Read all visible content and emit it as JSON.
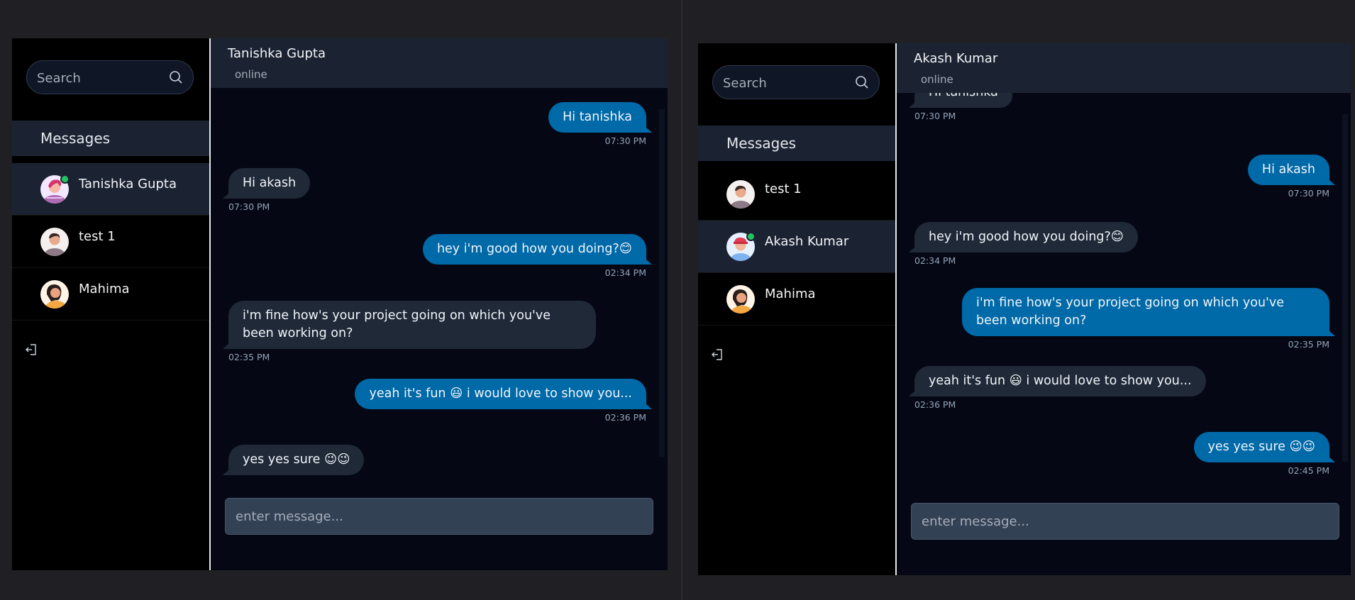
{
  "left": {
    "search_placeholder": "Search",
    "messages_header": "Messages",
    "contacts": [
      {
        "name": "Tanishka Gupta",
        "active": true,
        "online": true
      },
      {
        "name": "test 1"
      },
      {
        "name": "Mahima"
      }
    ],
    "chat": {
      "name": "Tanishka Gupta",
      "status": "online",
      "messages": [
        {
          "dir": "sent",
          "text": "Hi tanishka",
          "time": "07:30 PM"
        },
        {
          "dir": "recv",
          "text": "Hi akash",
          "time": "07:30 PM"
        },
        {
          "dir": "sent",
          "text": "hey i'm good how you doing?😊",
          "time": "02:34 PM"
        },
        {
          "dir": "recv",
          "text": "i'm fine how's your project going on which you've been working on?",
          "time": "02:35 PM"
        },
        {
          "dir": "sent",
          "text": "yeah it's fun 😃 i would love to show you...",
          "time": "02:36 PM"
        },
        {
          "dir": "recv",
          "text": "yes yes sure 😉😉",
          "time": ""
        }
      ],
      "input_placeholder": "enter message..."
    }
  },
  "right": {
    "search_placeholder": "Search",
    "messages_header": "Messages",
    "contacts": [
      {
        "name": "test 1"
      },
      {
        "name": "Akash Kumar",
        "active": true,
        "online": true
      },
      {
        "name": "Mahima"
      }
    ],
    "chat": {
      "name": "Akash Kumar",
      "status": "online",
      "messages": [
        {
          "dir": "recv",
          "text": "Hi tanishka",
          "time": "07:30 PM"
        },
        {
          "dir": "sent",
          "text": "Hi akash",
          "time": "07:30 PM"
        },
        {
          "dir": "recv",
          "text": "hey i'm good how you doing?😊",
          "time": "02:34 PM"
        },
        {
          "dir": "sent",
          "text": "i'm fine how's your project going on which you've been working on?",
          "time": "02:35 PM"
        },
        {
          "dir": "recv",
          "text": "yeah it's fun 😃 i would love to show you...",
          "time": "02:36 PM"
        },
        {
          "dir": "sent",
          "text": "yes yes sure 😉😉",
          "time": "02:45 PM"
        }
      ],
      "input_placeholder": "enter message..."
    }
  },
  "icons": {
    "search": "search-icon",
    "logout": "logout-icon"
  },
  "colors": {
    "sent_bubble": "#0069a8",
    "recv_bubble": "#1f2937",
    "online": "#22c55e"
  }
}
